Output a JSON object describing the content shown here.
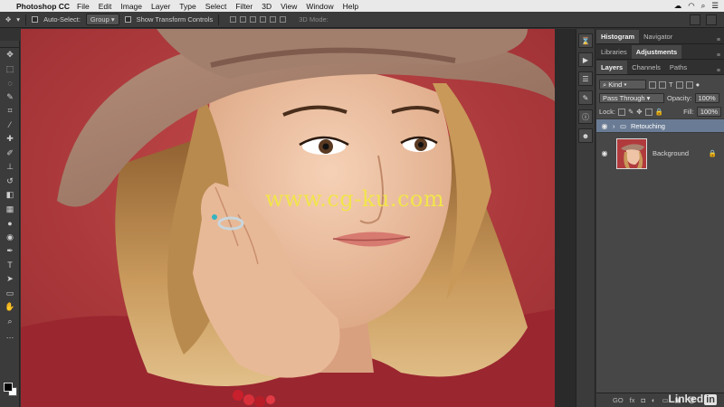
{
  "menubar": {
    "app_name": "Photoshop CC",
    "items": [
      "File",
      "Edit",
      "Image",
      "Layer",
      "Type",
      "Select",
      "Filter",
      "3D",
      "View",
      "Window",
      "Help"
    ]
  },
  "options_bar": {
    "auto_select_label": "Auto-Select:",
    "auto_select_value": "Group",
    "transform_label": "Show Transform Controls",
    "mode_3d_label": "3D Mode:"
  },
  "canvas": {
    "watermark": "www.cg-ku.com"
  },
  "panels": {
    "top_tabs": [
      "Histogram",
      "Navigator"
    ],
    "second_tabs": [
      "Libraries",
      "Adjustments"
    ],
    "layers_tabs": [
      "Layers",
      "Channels",
      "Paths"
    ],
    "kind_label": "Kind",
    "blend_mode": "Pass Through",
    "opacity_label": "Opacity:",
    "opacity_value": "100%",
    "lock_label": "Lock:",
    "fill_label": "Fill:",
    "fill_value": "100%",
    "layers": [
      {
        "name": "Retouching",
        "type": "group"
      },
      {
        "name": "Background",
        "type": "pixel"
      }
    ],
    "bottom_icons": [
      "GO",
      "fx"
    ]
  },
  "branding": {
    "linkedin_text": "Linked",
    "linkedin_in": "in"
  },
  "colors": {
    "group_highlight": "#6a7c95",
    "background_red": "#b13a3d",
    "watermark_yellow": "#f2e54a"
  }
}
